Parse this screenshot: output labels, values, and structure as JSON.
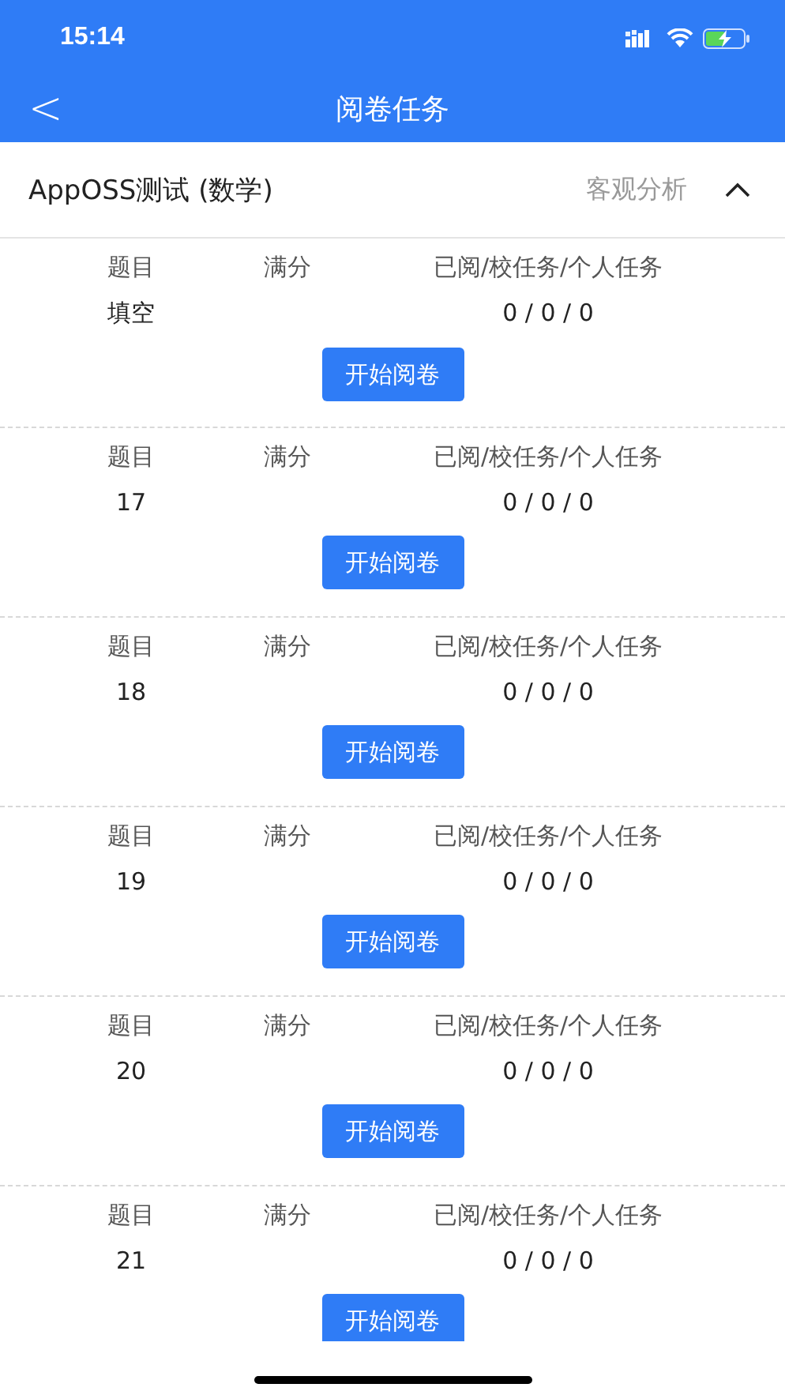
{
  "status_bar": {
    "time": "15:14"
  },
  "nav": {
    "back": "<",
    "title": "阅卷任务"
  },
  "exam": {
    "title": "AppOSS测试 (数学)",
    "action": "客观分析",
    "expanded": true
  },
  "tasks": [
    {
      "headers": [
        "题目",
        "满分",
        "已阅/校任务/个人任务"
      ],
      "question": "填空",
      "progress": "0 / 0 / 0",
      "button": "开始阅卷"
    },
    {
      "headers": [
        "题目",
        "满分",
        "已阅/校任务/个人任务"
      ],
      "question": "17",
      "progress": "0 / 0 / 0",
      "button": "开始阅卷"
    },
    {
      "headers": [
        "题目",
        "满分",
        "已阅/校任务/个人任务"
      ],
      "question": "18",
      "progress": "0 / 0 / 0",
      "button": "开始阅卷"
    },
    {
      "headers": [
        "题目",
        "满分",
        "已阅/校任务/个人任务"
      ],
      "question": "19",
      "progress": "0 / 0 / 0",
      "button": "开始阅卷"
    },
    {
      "headers": [
        "题目",
        "满分",
        "已阅/校任务/个人任务"
      ],
      "question": "20",
      "progress": "0 / 0 / 0",
      "button": "开始阅卷"
    },
    {
      "headers": [
        "题目",
        "满分",
        "已阅/校任务/个人任务"
      ],
      "question": "21",
      "progress": "0 / 0 / 0",
      "button": "开始阅卷"
    }
  ]
}
